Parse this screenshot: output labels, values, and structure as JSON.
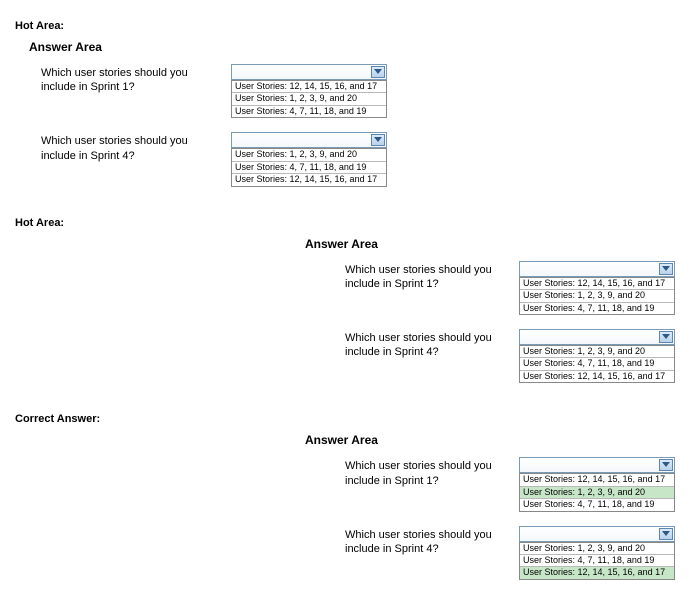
{
  "labels": {
    "hot_area": "Hot Area:",
    "correct_answer": "Correct Answer:",
    "answer_area": "Answer Area"
  },
  "questions": {
    "sprint1": "Which user stories should you include in Sprint 1?",
    "sprint4": "Which user stories should you include in Sprint 4?"
  },
  "options": {
    "a": "User Stories: 12, 14, 15, 16, and 17",
    "b": "User Stories: 1, 2, 3, 9, and 20",
    "c": "User Stories: 4, 7, 11, 18, and 19"
  },
  "sections": {
    "top": {
      "sprint1_order": [
        "a",
        "b",
        "c"
      ],
      "sprint4_order": [
        "b",
        "c",
        "a"
      ],
      "sprint1_selected": null,
      "sprint4_selected": null
    },
    "middle": {
      "sprint1_order": [
        "a",
        "b",
        "c"
      ],
      "sprint4_order": [
        "b",
        "c",
        "a"
      ],
      "sprint1_selected": null,
      "sprint4_selected": null
    },
    "correct": {
      "sprint1_order": [
        "a",
        "b",
        "c"
      ],
      "sprint4_order": [
        "b",
        "c",
        "a"
      ],
      "sprint1_selected": "b",
      "sprint4_selected": "a"
    }
  }
}
